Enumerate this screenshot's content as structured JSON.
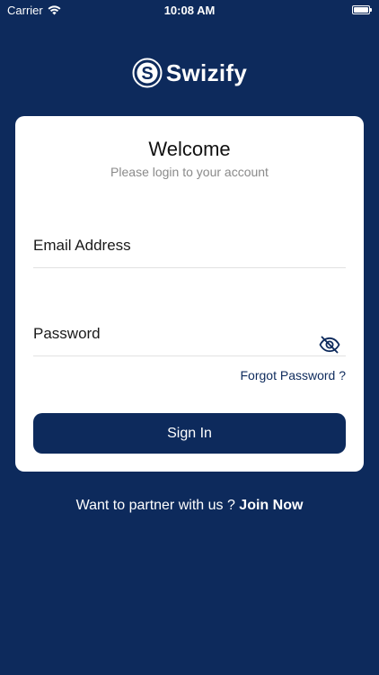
{
  "status_bar": {
    "carrier": "Carrier",
    "time": "10:08 AM",
    "wifi_icon": "wifi-icon",
    "battery_icon": "battery-icon"
  },
  "logo": {
    "text": "Swizify",
    "icon": "swizify-logo-icon"
  },
  "card": {
    "title": "Welcome",
    "subtitle": "Please login to your account"
  },
  "form": {
    "email_placeholder": "Email Address",
    "email_value": "",
    "password_placeholder": "Password",
    "password_value": "",
    "eye_icon": "eye-off-icon",
    "forgot_label": "Forgot Password ?",
    "signin_label": "Sign In"
  },
  "partner": {
    "prompt": "Want to partner with us ? ",
    "link_label": "Join Now"
  },
  "colors": {
    "background": "#0d2a5c",
    "card": "#ffffff",
    "primary": "#0d2a5c",
    "subtitle": "#8a8a8a"
  }
}
